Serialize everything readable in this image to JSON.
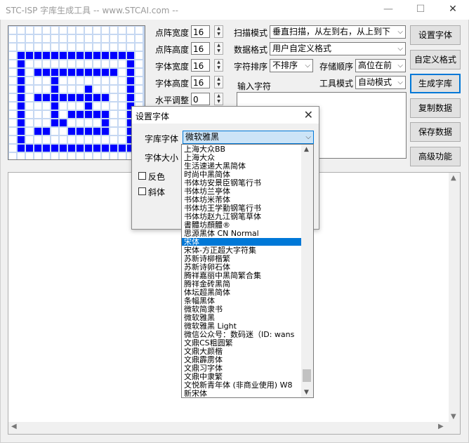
{
  "window": {
    "title": "STC-ISP 字库生成工具 -- www.STCAI.com --"
  },
  "fields": {
    "dot_width": {
      "label": "点阵宽度",
      "value": "16"
    },
    "dot_height": {
      "label": "点阵高度",
      "value": "16"
    },
    "char_width": {
      "label": "字体宽度",
      "value": "16"
    },
    "char_height": {
      "label": "字体高度",
      "value": "16"
    },
    "h_adjust": {
      "label": "水平调整",
      "value": "0"
    }
  },
  "options": {
    "scan_mode": {
      "label": "扫描模式",
      "value": "垂直扫描，从左到右，从上到下"
    },
    "data_format": {
      "label": "数据格式",
      "value": "用户自定义格式"
    },
    "char_sort": {
      "label": "字符排序",
      "value": "不排序"
    },
    "storage_order": {
      "label": "存储顺序",
      "value": "高位在前"
    },
    "tool_mode": {
      "label": "工具模式",
      "value": "自动模式"
    }
  },
  "input": {
    "label": "输入字符"
  },
  "buttons": {
    "set_font": "设置字体",
    "custom_format": "自定义格式",
    "generate": "生成字库",
    "copy_data": "复制数据",
    "save_data": "保存数据",
    "advanced": "高级功能"
  },
  "dialog": {
    "title": "设置字体",
    "font_label": "字库字体",
    "font_value": "微软雅黑",
    "size_label": "字体大小",
    "invert_label": "反色",
    "italic_label": "斜体"
  },
  "font_list": [
    "上海大众BB",
    "上海大众",
    "生活速递大黑简体",
    "时尚中黑简体",
    "书体坊安景臣钢笔行书",
    "书体坊兰亭体",
    "书体坊米芾体",
    "书体坊王学勤钢笔行书",
    "书体坊赵九江钢笔草体",
    "書體坊顏體®",
    "思源黑体 CN Normal",
    "宋体",
    "宋体-方正超大字符集",
    "苏新诗柳楷繁",
    "苏新诗卵石体",
    "腾祥嘉丽中黑简繁合集",
    "腾祥金砖黑简",
    "体坛超黑简体",
    "条幅黑体",
    "微软简隶书",
    "微软雅黑",
    "微软雅黑 Light",
    "微信公众号：数码迷（ID: wans",
    "文鼎CS粗圆繁",
    "文鼎大颜楷",
    "文鼎霹雳体",
    "文鼎习字体",
    "文鼎中隶繁",
    "文悦新青年体 (非商业使用) W8",
    "新宋体"
  ],
  "font_list_selected": "宋体",
  "glyph": {
    "on_color": "#0000ff",
    "off_color": "#c6d8f2",
    "bitmap": [
      "0000000000000000",
      "0000000000000000",
      "0000000000000000",
      "0111111111111110",
      "0100000000000010",
      "0101111111111010",
      "0100010000000010",
      "0100010001000010",
      "0101111111110010",
      "0100010001000010",
      "0100010111110010",
      "0100011000010010",
      "0101100111110010",
      "0100000000000010",
      "0111111111111110",
      "0000000000000000"
    ]
  }
}
